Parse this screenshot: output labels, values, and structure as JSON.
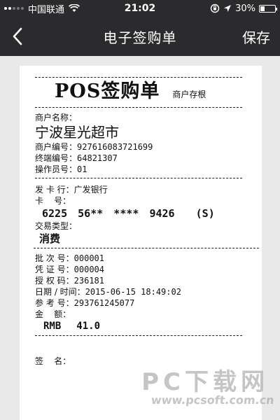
{
  "status_bar": {
    "carrier": "中国联通",
    "time": "21:02",
    "battery": "30%",
    "battery_level": 0.3
  },
  "nav": {
    "title": "电子签购单",
    "save_label": "保存"
  },
  "receipt": {
    "title": "POS签购单",
    "copy_label": "商户存根",
    "merchant_name_label": "商户名称：",
    "merchant_name": "宁波星光超市",
    "merchant_no_label": "商户编号：",
    "merchant_no": "927616083721699",
    "terminal_no_label": "终端编号：",
    "terminal_no": "64821307",
    "operator_label": "操作员号：",
    "operator": "01",
    "issuer_label": "发 卡 行：",
    "issuer": "广发银行",
    "card_label": "卡    号：",
    "card_number": "6225 56** **** 9426  (S)",
    "txn_type_label": "交易类型：",
    "txn_type": "消费",
    "batch_label": "批 次 号：",
    "batch_no": "000001",
    "voucher_label": "凭 证 号：",
    "voucher_no": "000004",
    "auth_label": "授 权 码：",
    "auth_code": "236181",
    "datetime_label": "日期 / 时间：",
    "datetime": "2015-06-15 18:49:02",
    "ref_label": "参 考 号：",
    "ref_no": "293761245077",
    "amount_label": "金    额：",
    "currency": "RMB",
    "amount": "41.0",
    "signature_label": "签    名："
  },
  "watermark": {
    "main": "PC下载网",
    "sub": "www.pcsoft.com.cn"
  }
}
